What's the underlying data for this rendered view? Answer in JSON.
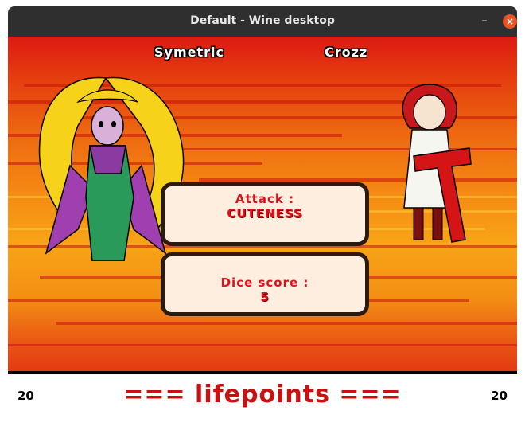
{
  "window": {
    "title": "Default - Wine desktop",
    "minimize": "–",
    "close": "×"
  },
  "players": {
    "left": {
      "name": "Symetric",
      "lifepoints": "20"
    },
    "right": {
      "name": "Crozz",
      "lifepoints": "20"
    }
  },
  "attack_panel": {
    "label": "Attack :",
    "value": "CUTENESS"
  },
  "dice_panel": {
    "label": "Dice score :",
    "value": "5"
  },
  "lifepoints_label": "=== lifepoints ===",
  "colors": {
    "accent": "#e0101a",
    "banner": "#cc1010",
    "background_top": "#dc1a12",
    "background_mid": "#f8a416"
  }
}
